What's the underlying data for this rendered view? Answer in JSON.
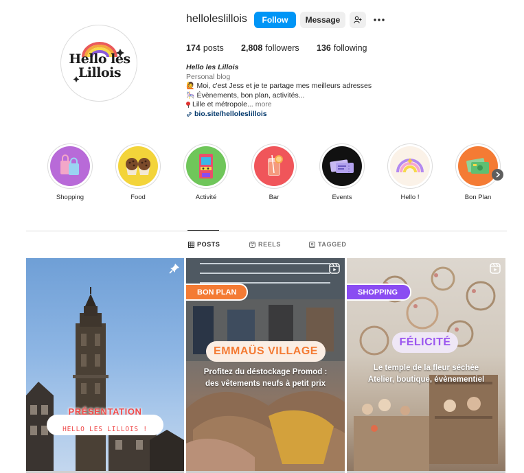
{
  "profile": {
    "username": "helloleslillois",
    "follow_label": "Follow",
    "message_label": "Message",
    "avatar_text_line1": "Hello les",
    "avatar_text_line2": "Lillois"
  },
  "stats": {
    "posts_count": "174",
    "posts_label": "posts",
    "followers_count": "2,808",
    "followers_label": "followers",
    "following_count": "136",
    "following_label": "following"
  },
  "bio": {
    "full_name": "Hello les Lillois",
    "category": "Personal blog",
    "line1": "Moi, c'est Jess et je te partage mes meilleurs adresses",
    "line2": "Évènements, bon plan, activités...",
    "line3": "Lille et métropole...",
    "more": "more",
    "link": "bio.site/helloleslillois"
  },
  "highlights": [
    {
      "label": "Shopping",
      "color": "#b86ad8"
    },
    {
      "label": "Food",
      "color": "#f3d43a"
    },
    {
      "label": "Activité",
      "color": "#6fc65a"
    },
    {
      "label": "Bar",
      "color": "#f0555a"
    },
    {
      "label": "Events",
      "color": "#111111"
    },
    {
      "label": "Hello !",
      "color": "#fbf2e8"
    },
    {
      "label": "Bon Plan",
      "color": "#f47b34"
    }
  ],
  "tabs": {
    "posts": "POSTS",
    "reels": "REELS",
    "tagged": "TAGGED"
  },
  "posts": {
    "post1": {
      "title": "PRÉSENTATION",
      "subtitle": "HELLO LES LILLOIS !"
    },
    "post2": {
      "tag": "BON PLAN",
      "title": "EMMAÜS VILLAGE",
      "caption_line1": "Profitez du déstockage Promod :",
      "caption_line2": "des vêtements neufs à petit prix"
    },
    "post3": {
      "tag": "SHOPPING",
      "title": "FÉLICITÉ",
      "caption_line1": "Le temple de la fleur séchée",
      "caption_line2": "Atelier, boutique, évènementiel"
    }
  },
  "colors": {
    "accent": "#0095f6",
    "link": "#00376b",
    "orange": "#f47b34",
    "purple": "#8a4cf2",
    "red": "#ef4a4a"
  }
}
